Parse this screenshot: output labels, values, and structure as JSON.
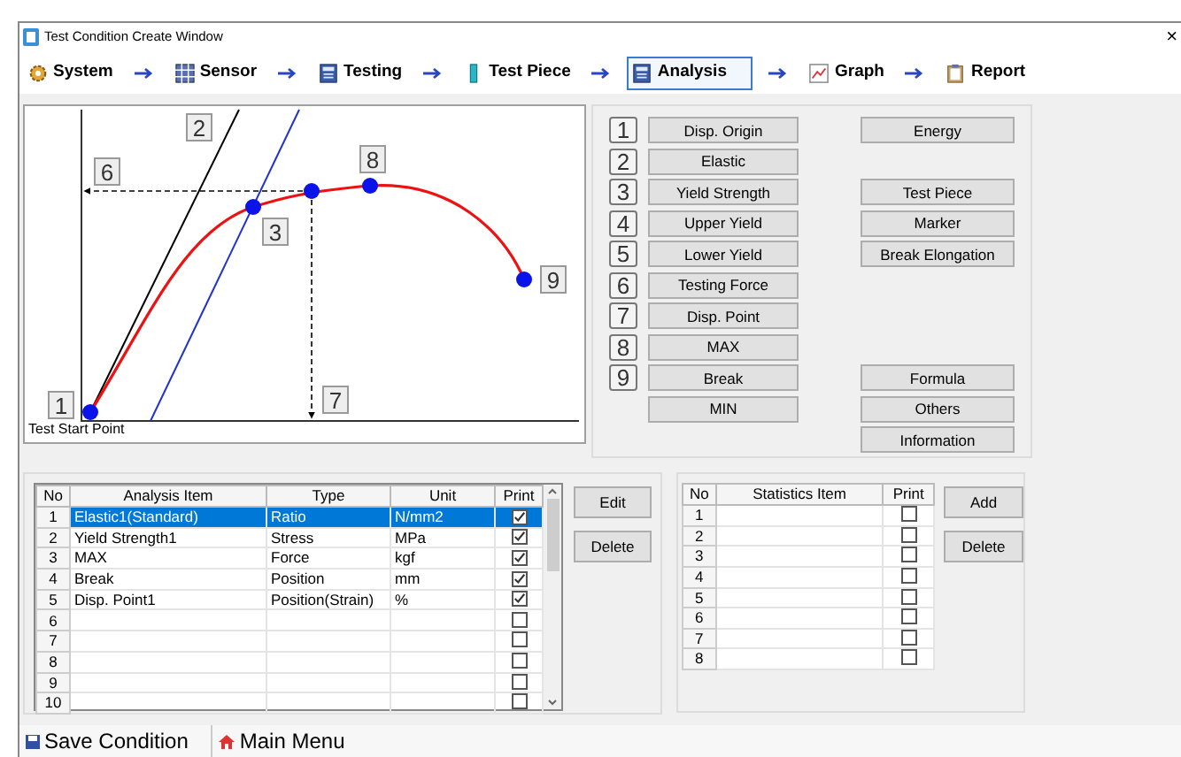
{
  "window": {
    "title": "Test Condition Create Window",
    "close": "×"
  },
  "steps": [
    {
      "kind": "gear",
      "label": "System",
      "selected": false
    },
    {
      "kind": "grid",
      "label": "Sensor",
      "selected": false
    },
    {
      "kind": "calc",
      "label": "Testing",
      "selected": false
    },
    {
      "kind": "bar",
      "label": "Test Piece",
      "selected": false
    },
    {
      "kind": "calc",
      "label": "Analysis",
      "selected": true
    },
    {
      "kind": "chart",
      "label": "Graph",
      "selected": false
    },
    {
      "kind": "clipboard",
      "label": "Report",
      "selected": false
    }
  ],
  "diagram": {
    "labels": [
      "1",
      "2",
      "3",
      "6",
      "7",
      "8",
      "9"
    ],
    "caption": "Test Start Point"
  },
  "analysis_buttons": [
    {
      "number": "1",
      "left": "Disp. Origin",
      "right": "Energy"
    },
    {
      "number": "2",
      "left": "Elastic"
    },
    {
      "number": "3",
      "left": "Yield Strength",
      "right": "Test Piece"
    },
    {
      "number": "4",
      "left": "Upper Yield",
      "right": "Marker"
    },
    {
      "number": "5",
      "left": "Lower Yield",
      "right": "Break Elongation"
    },
    {
      "number": "6",
      "left": "Testing Force"
    },
    {
      "number": "7",
      "left": "Disp. Point"
    },
    {
      "number": "8",
      "left": "MAX"
    },
    {
      "number": "9",
      "left": "Break",
      "right": "Formula"
    },
    {
      "left": "MIN",
      "right": "Others"
    },
    {
      "right": "Information"
    }
  ],
  "analysis_table": {
    "columns": [
      "No",
      "Analysis Item",
      "Type",
      "Unit",
      "Print"
    ],
    "rows": [
      {
        "no": "1",
        "item": "Elastic1(Standard)",
        "type": "Ratio",
        "unit": "N/mm2",
        "print": true,
        "selected": true
      },
      {
        "no": "2",
        "item": "Yield Strength1",
        "type": "Stress",
        "unit": "MPa",
        "print": true,
        "selected": false
      },
      {
        "no": "3",
        "item": "MAX",
        "type": "Force",
        "unit": "kgf",
        "print": true,
        "selected": false
      },
      {
        "no": "4",
        "item": "Break",
        "type": "Position",
        "unit": "mm",
        "print": true,
        "selected": false
      },
      {
        "no": "5",
        "item": "Disp. Point1",
        "type": "Position(Strain)",
        "unit": "%",
        "print": true,
        "selected": false
      },
      {
        "no": "6",
        "print": false,
        "selected": false
      },
      {
        "no": "7",
        "print": false,
        "selected": false
      },
      {
        "no": "8",
        "print": false,
        "selected": false
      },
      {
        "no": "9",
        "print": false,
        "selected": false
      },
      {
        "no": "10",
        "print": false,
        "selected": false
      }
    ],
    "buttons": [
      "Edit",
      "Delete"
    ]
  },
  "statistics_table": {
    "columns": [
      "No",
      "Statistics Item",
      "Print"
    ],
    "rows": [
      {
        "no": "1",
        "print": false
      },
      {
        "no": "2",
        "print": false
      },
      {
        "no": "3",
        "print": false
      },
      {
        "no": "4",
        "print": false
      },
      {
        "no": "5",
        "print": false
      },
      {
        "no": "6",
        "print": false
      },
      {
        "no": "7",
        "print": false
      },
      {
        "no": "8",
        "print": false
      }
    ],
    "buttons": [
      "Add",
      "Delete"
    ]
  },
  "footer": [
    {
      "kind": "save",
      "label": "Save Condition"
    },
    {
      "kind": "home",
      "label": "Main Menu"
    }
  ]
}
